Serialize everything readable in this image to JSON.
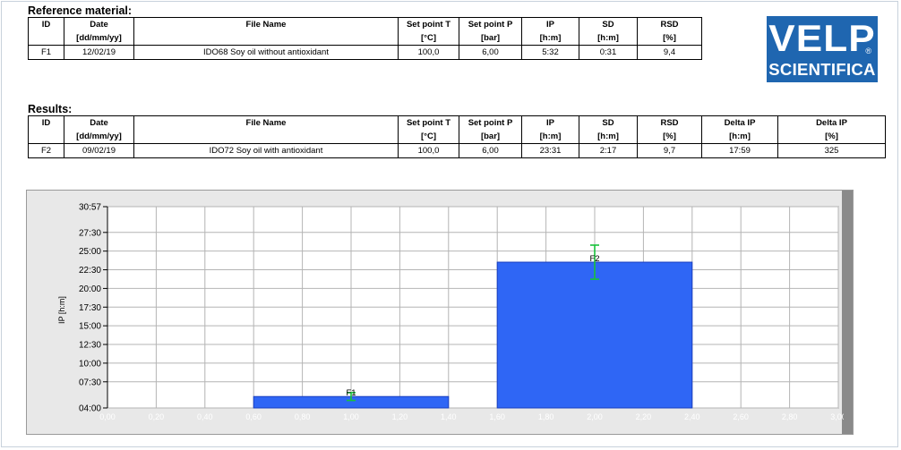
{
  "reference": {
    "title": "Reference material:",
    "headers": [
      "ID",
      "Date",
      "File Name",
      "Set point T",
      "Set point P",
      "IP",
      "SD",
      "RSD"
    ],
    "units": [
      "",
      "[dd/mm/yy]",
      "",
      "[°C]",
      "[bar]",
      "[h:m]",
      "[h:m]",
      "[%]"
    ],
    "rows": [
      [
        "F1",
        "12/02/19",
        "IDO68 Soy oil without antioxidant",
        "100,0",
        "6,00",
        "5:32",
        "0:31",
        "9,4"
      ]
    ]
  },
  "results": {
    "title": "Results:",
    "headers": [
      "ID",
      "Date",
      "File Name",
      "Set point T",
      "Set point P",
      "IP",
      "SD",
      "RSD",
      "Delta IP",
      "Delta IP"
    ],
    "units": [
      "",
      "[dd/mm/yy]",
      "",
      "[°C]",
      "[bar]",
      "[h:m]",
      "[h:m]",
      "[%]",
      "[h:m]",
      "[%]"
    ],
    "rows": [
      [
        "F2",
        "09/02/19",
        "IDO72 Soy oil with antioxidant",
        "100,0",
        "6,00",
        "23:31",
        "2:17",
        "9,7",
        "17:59",
        "325"
      ]
    ]
  },
  "logo": {
    "line1": "VELP",
    "line2": "SCIENTIFICA",
    "mark": "®"
  },
  "colors": {
    "bar": "#2f66f5",
    "bar_edge": "#1a3fc0",
    "error_bar": "#18c23a",
    "plot_bg": "#ffffff",
    "logo_bg": "#1f66b0"
  },
  "chart_data": {
    "type": "bar",
    "ylabel": "IP [h:m]",
    "xlabel": "",
    "xlim": [
      0.0,
      3.0
    ],
    "ylim": [
      4.0,
      30.95
    ],
    "grid": true,
    "y_ticks": [
      {
        "value": 4.0,
        "label": "04:00"
      },
      {
        "value": 7.5,
        "label": "07:30"
      },
      {
        "value": 10.0,
        "label": "10:00"
      },
      {
        "value": 12.5,
        "label": "12:30"
      },
      {
        "value": 15.0,
        "label": "15:00"
      },
      {
        "value": 17.5,
        "label": "17:30"
      },
      {
        "value": 20.0,
        "label": "20:00"
      },
      {
        "value": 22.5,
        "label": "22:30"
      },
      {
        "value": 25.0,
        "label": "25:00"
      },
      {
        "value": 27.5,
        "label": "27:30"
      },
      {
        "value": 30.95,
        "label": "30:57"
      }
    ],
    "x_ticks": [
      {
        "value": 0.0,
        "label": "0,00"
      },
      {
        "value": 0.2,
        "label": "0,20"
      },
      {
        "value": 0.4,
        "label": "0,40"
      },
      {
        "value": 0.6,
        "label": "0,60"
      },
      {
        "value": 0.8,
        "label": "0,80"
      },
      {
        "value": 1.0,
        "label": "1,00"
      },
      {
        "value": 1.2,
        "label": "1,20"
      },
      {
        "value": 1.4,
        "label": "1,40"
      },
      {
        "value": 1.6,
        "label": "1,60"
      },
      {
        "value": 1.8,
        "label": "1,80"
      },
      {
        "value": 2.0,
        "label": "2,00"
      },
      {
        "value": 2.2,
        "label": "2,20"
      },
      {
        "value": 2.4,
        "label": "2,40"
      },
      {
        "value": 2.6,
        "label": "2,60"
      },
      {
        "value": 2.8,
        "label": "2,80"
      },
      {
        "value": 3.0,
        "label": "3,00"
      }
    ],
    "bars": [
      {
        "label": "F1",
        "x_start": 0.6,
        "x_end": 1.4,
        "x_center": 1.0,
        "value": 5.53,
        "sd": 0.52
      },
      {
        "label": "F2",
        "x_start": 1.6,
        "x_end": 2.4,
        "x_center": 2.0,
        "value": 23.52,
        "sd": 2.28
      }
    ]
  }
}
